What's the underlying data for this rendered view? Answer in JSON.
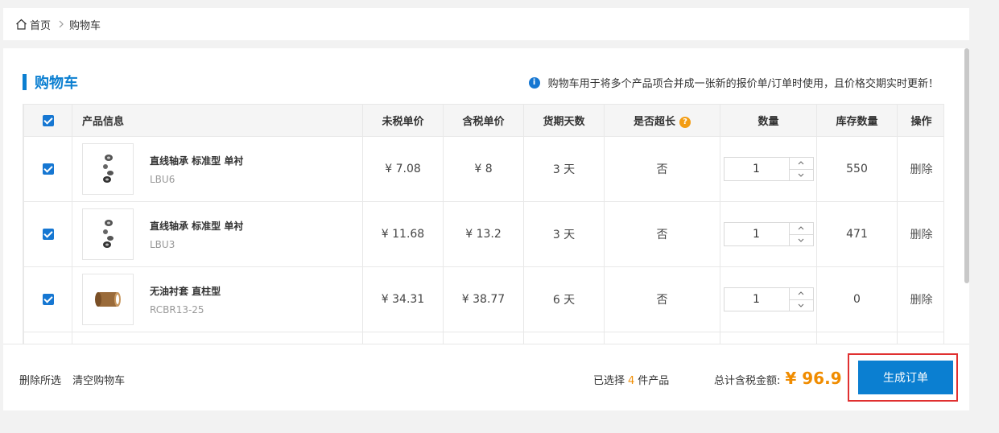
{
  "breadcrumb": {
    "home": "首页",
    "current": "购物车"
  },
  "title": "购物车",
  "notice": "购物车用于将多个产品项合并成一张新的报价单/订单时使用，且价格交期实时更新！",
  "columns": [
    "产品信息",
    "未税单价",
    "含税单价",
    "货期天数",
    "是否超长",
    "数量",
    "库存数量",
    "操作"
  ],
  "rows": [
    {
      "name": "直线轴承 标准型 单衬",
      "code": "LBU6",
      "price": "¥ 7.08",
      "tax_price": "¥ 8",
      "days": "3 天",
      "over": "否",
      "qty": "1",
      "stock": "550",
      "action": "删除",
      "image": "bearing-icon"
    },
    {
      "name": "直线轴承 标准型 单衬",
      "code": "LBU3",
      "price": "¥ 11.68",
      "tax_price": "¥ 13.2",
      "days": "3 天",
      "over": "否",
      "qty": "1",
      "stock": "471",
      "action": "删除",
      "image": "bearing-icon"
    },
    {
      "name": "无油衬套 直柱型",
      "code": "RCBR13-25",
      "price": "¥ 34.31",
      "tax_price": "¥ 38.77",
      "days": "6 天",
      "over": "否",
      "qty": "1",
      "stock": "0",
      "action": "删除",
      "image": "bushing-icon"
    }
  ],
  "footer": {
    "delete_selected": "删除所选",
    "clear_cart": "清空购物车",
    "selected_prefix": "已选择",
    "selected_count": "4",
    "selected_suffix": "件产品",
    "total_label": "总计含税金额:",
    "total_amount": "¥ 96.9",
    "generate_button": "生成订单"
  },
  "colors": {
    "accent": "#0b7fd1",
    "price": "#f08c00",
    "highlight": "#e03030"
  }
}
